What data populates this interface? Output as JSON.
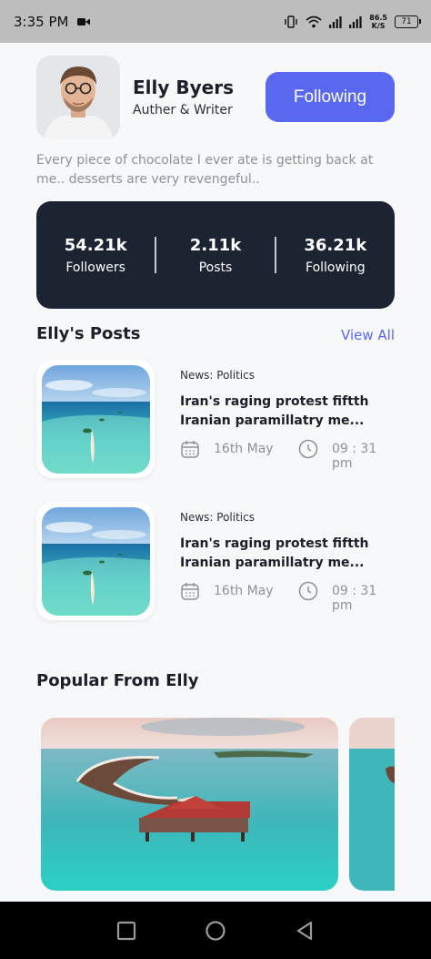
{
  "status_bar": {
    "time": "3:35 PM",
    "net_speed_value": "86.5",
    "net_speed_unit": "K/S",
    "battery": "71",
    "icons": [
      "video-record-icon",
      "vibrate-icon",
      "wifi-icon",
      "signal-icon",
      "signal-icon",
      "battery-icon"
    ]
  },
  "profile": {
    "name": "Elly Byers",
    "role": "Auther & Writer",
    "follow_label": "Following",
    "bio": "Every piece of chocolate I ever ate is getting back at me.. desserts are very revengeful.."
  },
  "stats": [
    {
      "value": "54.21k",
      "label": "Followers"
    },
    {
      "value": "2.11k",
      "label": "Posts"
    },
    {
      "value": "36.21k",
      "label": "Following"
    }
  ],
  "posts_section": {
    "title": "Elly's Posts",
    "view_all": "View All",
    "posts": [
      {
        "category": "News: Politics",
        "title": "Iran's raging protest fiftth Iranian paramillatry me...",
        "date": "16th May",
        "time": "09 : 31 pm"
      },
      {
        "category": "News: Politics",
        "title": "Iran's raging protest fiftth Iranian paramillatry me...",
        "date": "16th May",
        "time": "09 : 31 pm"
      }
    ]
  },
  "popular_section": {
    "title": "Popular From Elly"
  },
  "colors": {
    "accent": "#5a68f0",
    "card_dark": "#1c2331",
    "muted_text": "#8e9199"
  }
}
